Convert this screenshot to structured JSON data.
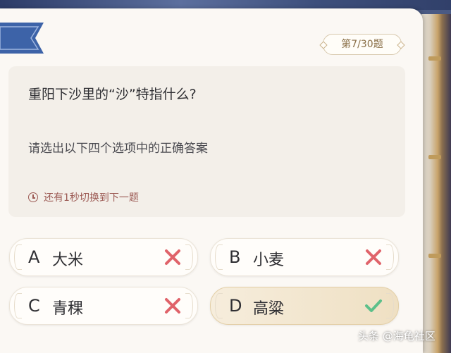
{
  "top_strip": {
    "text": ""
  },
  "progress": {
    "label": "第7/30题"
  },
  "question": {
    "title": "重阳下沙里的“沙”特指什么?",
    "subtitle": "请选出以下四个选项中的正确答案",
    "timer_text": "还有1秒切换到下一题"
  },
  "options": [
    {
      "letter": "A",
      "text": "大米",
      "result": "wrong"
    },
    {
      "letter": "B",
      "text": "小麦",
      "result": "wrong"
    },
    {
      "letter": "C",
      "text": "青稞",
      "result": "wrong"
    },
    {
      "letter": "D",
      "text": "高粱",
      "result": "correct"
    }
  ],
  "watermark": "头条 @海龟社区",
  "colors": {
    "wrong": "#e0636a",
    "correct": "#5cc08a",
    "ribbon": "#3d63a8",
    "timer": "#9c5a54"
  }
}
